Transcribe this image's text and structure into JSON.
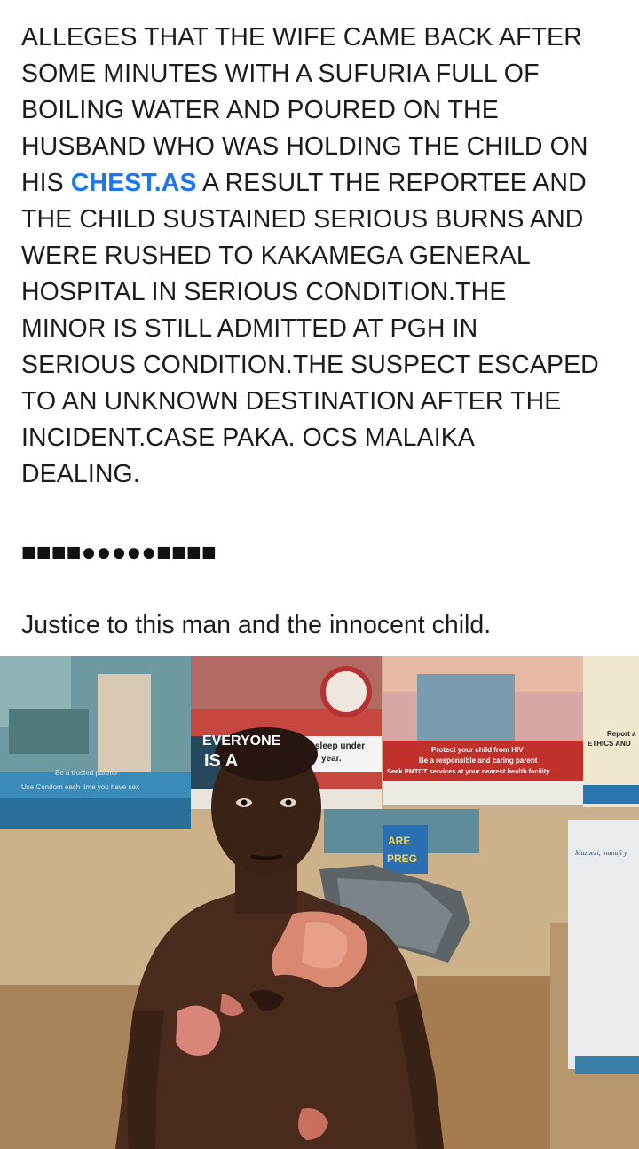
{
  "post": {
    "lines": [
      "ALLEGES THAT THE  WIFE CAME BACK AFTER",
      "SOME MINUTES WITH A  SUFURIA FULL OF",
      "BOILING WATER AND POURED ON THE",
      "HUSBAND WHO WAS HOLDING THE CHILD ON",
      "A RESULT THE REPORTEE AND",
      "THE CHILD SUSTAINED SERIOUS BURNS AND",
      "WERE RUSHED TO KAKAMEGA GENERAL",
      "HOSPITAL IN SERIOUS CONDITION.THE",
      "MINOR IS STILL ADMITTED AT PGH IN",
      "SERIOUS CONDITION.THE SUSPECT ESCAPED",
      "TO AN UNKNOWN DESTINATION AFTER THE",
      "INCIDENT.CASE PAKA. OCS MALAIKA",
      "DEALING."
    ],
    "line5_prefix": "HIS ",
    "hashtag": "CHEST.AS",
    "line5_suffix": " A RESULT THE REPORTEE AND",
    "separator": "■■■■●●●●●■■■■",
    "closing": "Justice to this man and the innocent child."
  },
  "photo": {
    "poster_everyone": "EVERYONE",
    "poster_isa": "IS A",
    "poster_sleep": "sleep under",
    "poster_year": "year.",
    "poster_hiv_1": "Protect your child from HIV",
    "poster_hiv_2": "Be a responsible and caring parent",
    "poster_hiv_3": "Seek PMTCT services at your nearest health facility",
    "poster_partner_1": "Be a trusted partner",
    "poster_partner_2": "Use Condom each time you have sex",
    "poster_report": "Report a",
    "poster_ethics": "ETHICS AND",
    "poster_are": "ARE",
    "poster_preg": "PREG",
    "poster_mazoezi": "Mazoezi, manufi y"
  },
  "colors": {
    "text": "#1c1c1c",
    "hashtag": "#1877f2"
  }
}
